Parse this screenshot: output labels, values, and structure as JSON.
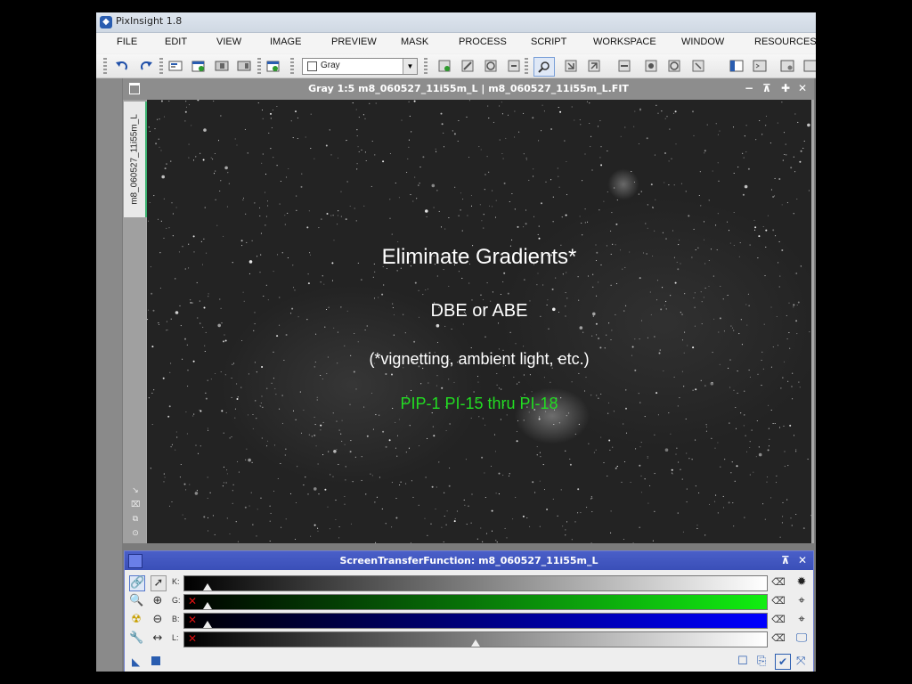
{
  "window": {
    "app_title": "PixInsight 1.8"
  },
  "menu": [
    "FILE",
    "EDIT",
    "VIEW",
    "IMAGE",
    "PREVIEW",
    "MASK",
    "PROCESS",
    "SCRIPT",
    "WORKSPACE",
    "WINDOW",
    "RESOURCES"
  ],
  "toolbar": {
    "colorspace_value": "Gray"
  },
  "image_window": {
    "title": "Gray 1:5 m8_060527_11i55m_L | m8_060527_11i55m_L.FIT",
    "tab_label": "m8_060527_11i55m_L"
  },
  "slide": {
    "heading": "Eliminate Gradients*",
    "method": "DBE or ABE",
    "note": "(*vignetting, ambient light, etc.)",
    "reference": "PIP-1 PI-15 thru PI-18"
  },
  "stf": {
    "title": "ScreenTransferFunction: m8_060527_11i55m_L",
    "channels": [
      {
        "label": "K:",
        "color": "#ffffff",
        "midtone": 0.04
      },
      {
        "label": "G:",
        "color": "#11ee11",
        "midtone": 0.04
      },
      {
        "label": "B:",
        "color": "#0000ff",
        "midtone": 0.04
      },
      {
        "label": "L:",
        "color": "#ffffff",
        "midtone": 0.5
      }
    ]
  },
  "colors": {
    "stf_titlebar": "#3a4fb8",
    "slide_reference": "#22dd22"
  }
}
